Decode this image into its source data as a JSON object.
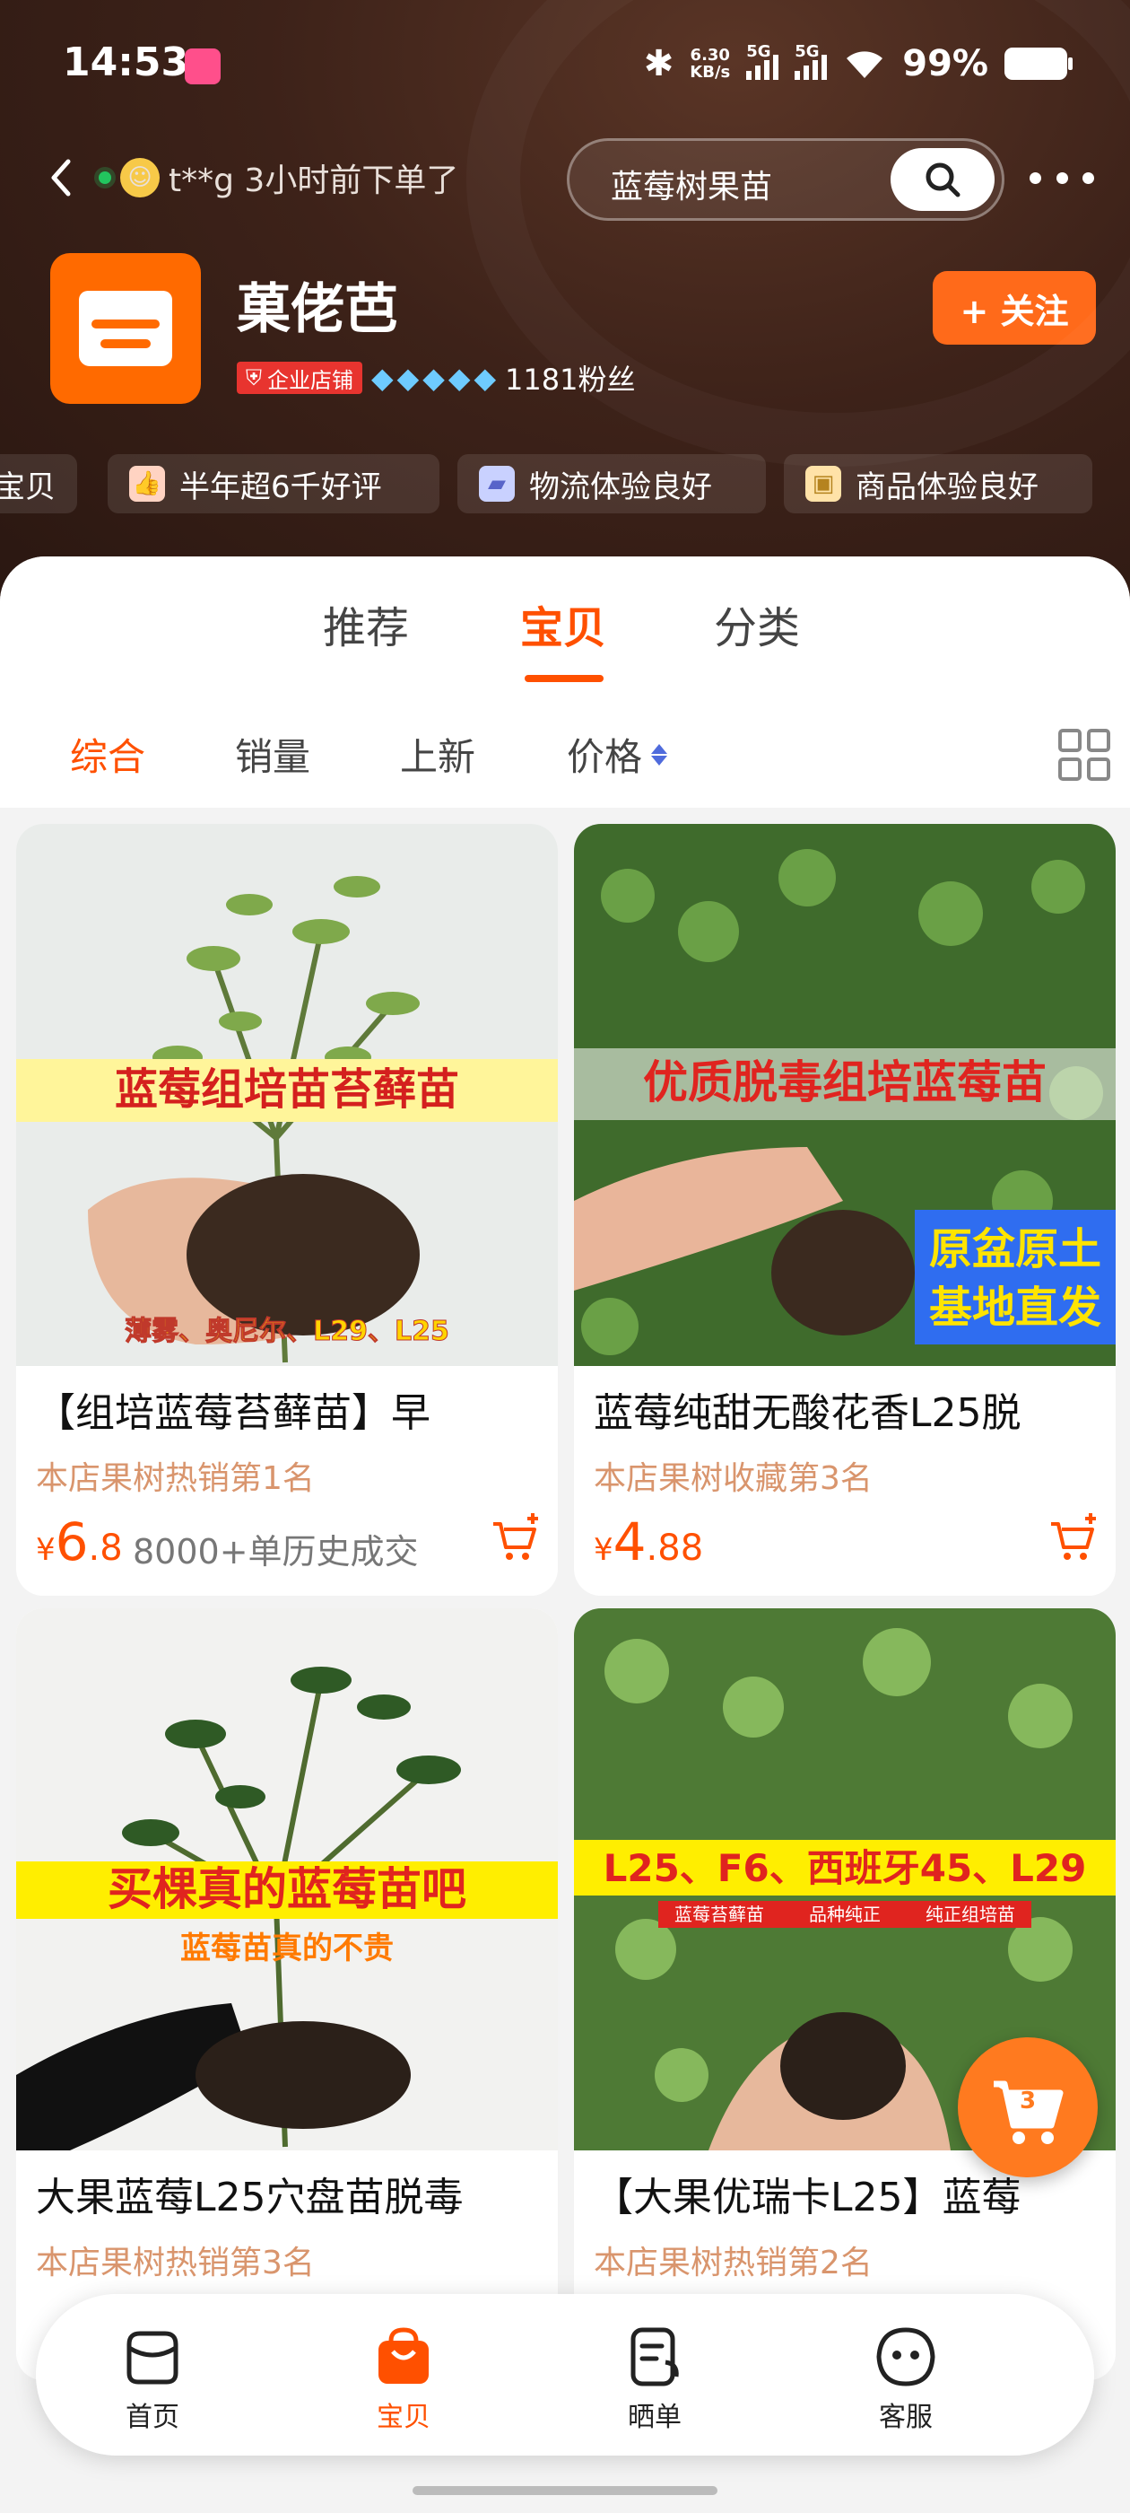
{
  "status_bar": {
    "time": "14:53",
    "net_speed_value": "6.30",
    "net_speed_unit": "KB/s",
    "signal_label_1": "5G",
    "signal_label_2": "5G",
    "battery_text": "99%"
  },
  "nav": {
    "order_notice": "t**g 3小时前下单了",
    "search_text": "蓝莓树果苗"
  },
  "shop": {
    "name": "菓佬芭",
    "enterprise_badge": "企业店铺",
    "diamond_count": 5,
    "fans": "1181粉丝",
    "follow_label": "+ 关注"
  },
  "badges": [
    {
      "label": "宝贝",
      "icon": "none"
    },
    {
      "label": "半年超6千好评",
      "icon": "thumbs-up-icon"
    },
    {
      "label": "物流体验良好",
      "icon": "truck-icon"
    },
    {
      "label": "商品体验良好",
      "icon": "bag-icon"
    }
  ],
  "tabs": [
    {
      "label": "推荐",
      "active": false
    },
    {
      "label": "宝贝",
      "active": true
    },
    {
      "label": "分类",
      "active": false
    }
  ],
  "sort": [
    {
      "label": "综合",
      "active": true
    },
    {
      "label": "销量",
      "active": false
    },
    {
      "label": "上新",
      "active": false
    },
    {
      "label": "价格",
      "active": false
    }
  ],
  "products": [
    {
      "title": "【组培蓝莓苔藓苗】早",
      "rank": "本店果树热销第1名",
      "price_currency": "¥",
      "price_int": "6",
      "price_dec": ".8",
      "sales": "8000+单历史成交",
      "img_banner": "蓝莓组培苗苔藓苗",
      "img_footer": "薄雾、奥尼尔、L29、L25"
    },
    {
      "title": "蓝莓纯甜无酸花香L25脱",
      "rank": "本店果树收藏第3名",
      "price_currency": "¥",
      "price_int": "4",
      "price_dec": ".88",
      "sales": "",
      "img_banner": "优质脱毒组培蓝莓苗",
      "img_box_1": "原盆原土",
      "img_box_2": "基地直发"
    },
    {
      "title": "大果蓝莓L25穴盘苗脱毒",
      "rank": "本店果树热销第3名",
      "img_banner": "买棵真的蓝莓苗吧",
      "img_sub": "蓝莓苗真的不贵"
    },
    {
      "title": "【大果优瑞卡L25】蓝莓",
      "rank": "本店果树热销第2名",
      "img_banner": "L25、F6、西班牙45、L29",
      "img_tags": [
        "蓝莓苔藓苗",
        "品种纯正",
        "纯正组培苗"
      ]
    }
  ],
  "floating_cart": {
    "count": "3"
  },
  "bottom_nav": [
    {
      "label": "首页",
      "icon": "shop-home-icon",
      "active": false
    },
    {
      "label": "宝贝",
      "icon": "bag-icon",
      "active": true
    },
    {
      "label": "晒单",
      "icon": "review-icon",
      "active": false
    },
    {
      "label": "客服",
      "icon": "service-icon",
      "active": false
    }
  ],
  "colors": {
    "accent": "#ff5000",
    "follow_button": "#ff6a1a",
    "header_bg": "#3d2219",
    "rank_text": "#d9956d"
  }
}
